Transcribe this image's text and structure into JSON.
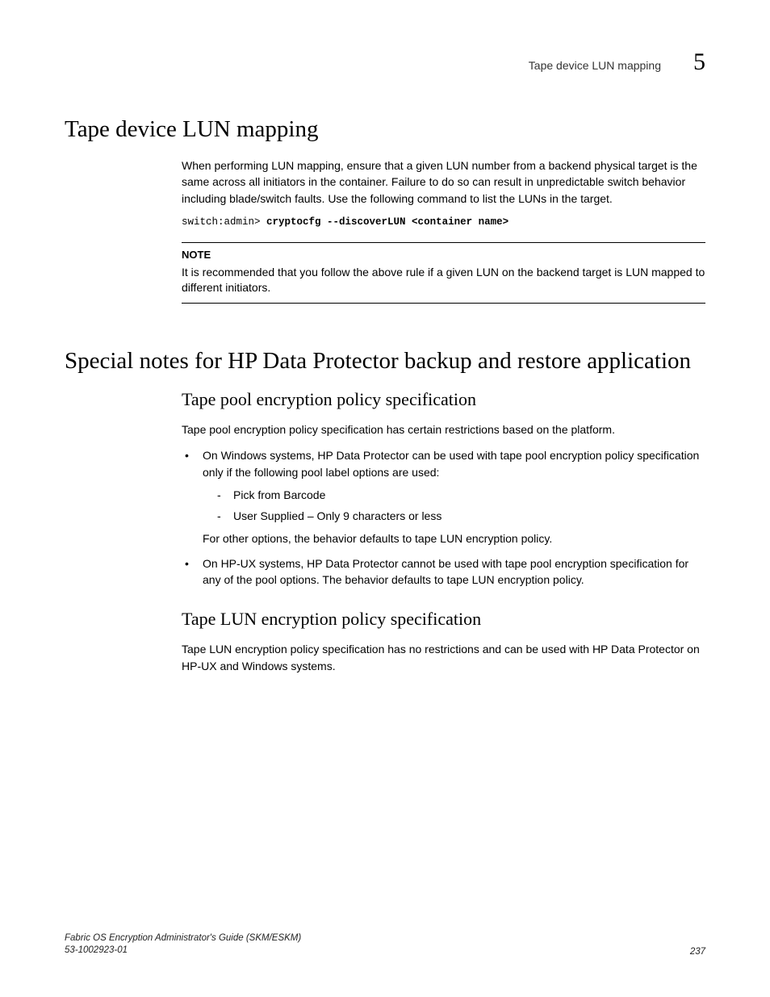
{
  "header": {
    "running_text": "Tape device LUN mapping",
    "chapter_number": "5"
  },
  "section1": {
    "title": "Tape device LUN mapping",
    "para1": "When performing LUN mapping, ensure that a given LUN number from a backend physical target is the same across all initiators in the container. Failure to do so can result in unpredictable switch behavior including blade/switch faults. Use the following command to list the LUNs in the target.",
    "code_prompt": "switch:admin> ",
    "code_command": "cryptocfg --discoverLUN <container name>",
    "note_label": "NOTE",
    "note_text": "It is recommended that you follow the above rule if a given LUN on the backend target is LUN mapped to different initiators."
  },
  "section2": {
    "title": "Special notes for HP Data Protector backup and restore application",
    "sub1": {
      "title": "Tape pool encryption policy specification",
      "intro": "Tape pool encryption policy specification has certain restrictions based on the platform.",
      "bullets": [
        {
          "text": "On Windows systems, HP Data Protector can be used with tape pool encryption policy specification only if the following pool label options are used:",
          "subitems": [
            "Pick from Barcode",
            "User Supplied – Only 9 characters or less"
          ],
          "trailing": "For other options, the behavior defaults to tape LUN encryption policy."
        },
        {
          "text": "On HP-UX systems, HP Data Protector cannot be used with tape pool encryption specification for any of the pool options. The behavior defaults to tape LUN encryption policy."
        }
      ]
    },
    "sub2": {
      "title": "Tape LUN encryption policy specification",
      "para": "Tape LUN encryption policy specification has no restrictions and can be used with HP Data Protector on HP-UX and Windows systems."
    }
  },
  "footer": {
    "guide": "Fabric OS Encryption Administrator's Guide (SKM/ESKM)",
    "docnum": "53-1002923-01",
    "page": "237"
  }
}
